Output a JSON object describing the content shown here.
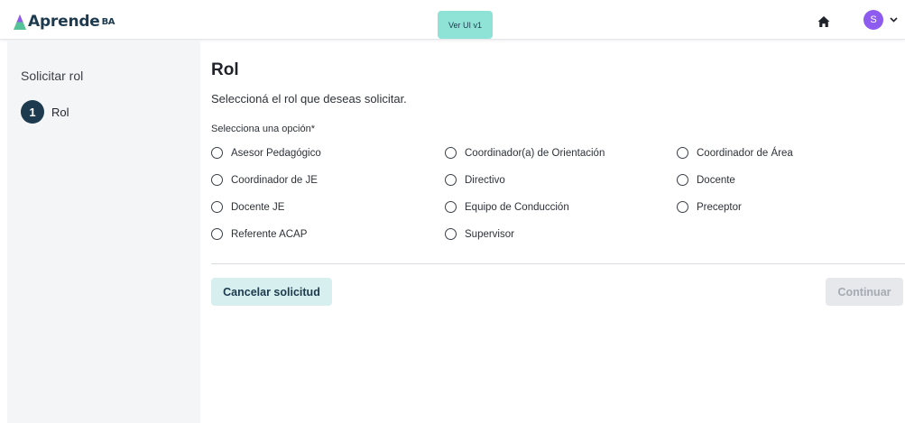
{
  "header": {
    "logo_text": "Aprende",
    "logo_suffix": "BA",
    "version_button": "Ver UI v1",
    "home_icon": "home-icon",
    "user_initial": "S",
    "avatar_color": "#8e5bf0"
  },
  "sidebar": {
    "title": "Solicitar rol",
    "steps": [
      {
        "number": "1",
        "label": "Rol"
      }
    ]
  },
  "main": {
    "title": "Rol",
    "subtitle": "Seleccioná el rol que deseas solicitar.",
    "field_label": "Selecciona una opción*",
    "options": [
      "Asesor Pedagógico",
      "Coordinador(a) de Orientación",
      "Coordinador de Área",
      "Coordinador de JE",
      "Directivo",
      "Docente",
      "Docente JE",
      "Equipo de Conducción",
      "Preceptor",
      "Referente ACAP",
      "Supervisor"
    ],
    "cancel_label": "Cancelar solicitud",
    "continue_label": "Continuar"
  },
  "colors": {
    "brand_dark": "#1d3a4e",
    "version_pill": "#8fe2d6",
    "cancel_bg": "#d7efee",
    "sidebar_bg": "#f4f5f7"
  }
}
